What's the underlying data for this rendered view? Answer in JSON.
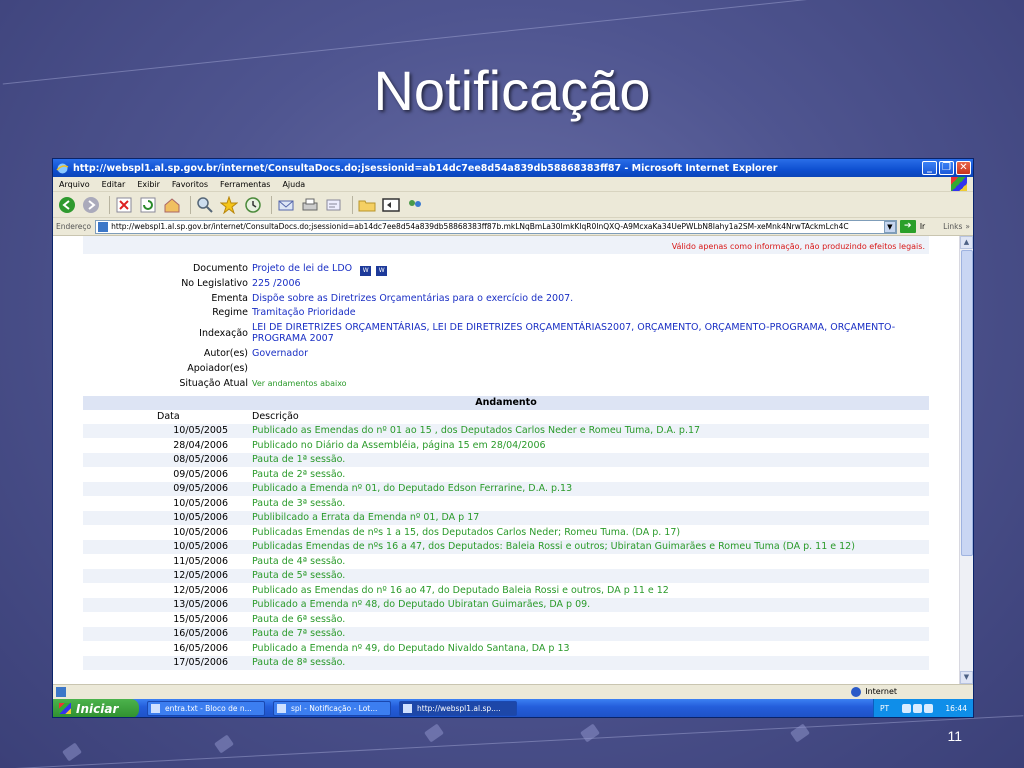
{
  "slide": {
    "title": "Notificação",
    "page_number": "11"
  },
  "browser": {
    "window_title": "http://webspl1.al.sp.gov.br/internet/ConsultaDocs.do;jsessionid=ab14dc7ee8d54a839db58868383ff87 - Microsoft Internet Explorer",
    "menu": [
      "Arquivo",
      "Editar",
      "Exibir",
      "Favoritos",
      "Ferramentas",
      "Ajuda"
    ],
    "address_label": "Endereço",
    "address_url": "http://webspl1.al.sp.gov.br/internet/ConsultaDocs.do;jsessionid=ab14dc7ee8d54a839db58868383ff87b.mkLNqBmLa30ImkKIqR0InQXQ-A9McxaKa34UePWLbN8Iahy1a2SM-xeMnk4NrwTAckmLch4C",
    "go_label": "Ir",
    "links_label": "Links",
    "status_zone": "Internet"
  },
  "page": {
    "notice": "Válido apenas como informação, não produzindo efeitos legais.",
    "fields": {
      "documento_label": "Documento",
      "documento_value": "Projeto de lei de LDO",
      "legislativo_label": "No Legislativo",
      "legislativo_value": "225 /2006",
      "ementa_label": "Ementa",
      "ementa_value": "Dispõe sobre as Diretrizes Orçamentárias para o exercício de 2007.",
      "regime_label": "Regime",
      "regime_value": "Tramitação Prioridade",
      "indexacao_label": "Indexação",
      "indexacao_value": "LEI DE DIRETRIZES ORÇAMENTÁRIAS, LEI DE DIRETRIZES ORÇAMENTÁRIAS2007, ORÇAMENTO, ORÇAMENTO-PROGRAMA, ORÇAMENTO-PROGRAMA 2007",
      "autor_label": "Autor(es)",
      "autor_value": "Governador",
      "apoiador_label": "Apoiador(es)",
      "apoiador_value": "",
      "situacao_label": "Situação Atual",
      "situacao_value": "Ver andamentos abaixo"
    },
    "andamento": {
      "title": "Andamento",
      "col_date": "Data",
      "col_desc": "Descrição",
      "rows": [
        {
          "date": "10/05/2005",
          "desc": "Publicado as Emendas do nº 01 ao 15 , dos Deputados Carlos Neder e Romeu Tuma, D.A. p.17"
        },
        {
          "date": "28/04/2006",
          "desc": "Publicado no Diário da Assembléia, página 15 em 28/04/2006"
        },
        {
          "date": "08/05/2006",
          "desc": "Pauta de 1ª sessão."
        },
        {
          "date": "09/05/2006",
          "desc": "Pauta de 2ª sessão."
        },
        {
          "date": "09/05/2006",
          "desc": "Publicado a Emenda nº 01, do Deputado Edson Ferrarine, D.A. p.13"
        },
        {
          "date": "10/05/2006",
          "desc": "Pauta de 3ª sessão."
        },
        {
          "date": "10/05/2006",
          "desc": "Publibilcado a Errata da Emenda nº 01, DA p 17"
        },
        {
          "date": "10/05/2006",
          "desc": "Publicadas Emendas de nºs 1 a 15, dos Deputados Carlos Neder; Romeu Tuma. (DA p. 17)"
        },
        {
          "date": "10/05/2006",
          "desc": "Publicadas Emendas de nºs 16 a 47, dos Deputados: Baleia Rossi e outros; Ubiratan Guimarães e Romeu Tuma (DA p. 11 e 12)"
        },
        {
          "date": "11/05/2006",
          "desc": "Pauta de 4ª sessão."
        },
        {
          "date": "12/05/2006",
          "desc": "Pauta de 5ª sessão."
        },
        {
          "date": "12/05/2006",
          "desc": "Publicado as Emendas do nº 16 ao 47, do Deputado Baleia Rossi e outros, DA p 11 e 12"
        },
        {
          "date": "13/05/2006",
          "desc": "Publicado a Emenda nº 48, do Deputado Ubiratan Guimarães, DA p 09."
        },
        {
          "date": "15/05/2006",
          "desc": "Pauta de 6ª sessão."
        },
        {
          "date": "16/05/2006",
          "desc": "Pauta de 7ª sessão."
        },
        {
          "date": "16/05/2006",
          "desc": "Publicado a Emenda nº 49, do Deputado Nivaldo Santana, DA p 13"
        },
        {
          "date": "17/05/2006",
          "desc": "Pauta de 8ª sessão."
        }
      ]
    }
  },
  "taskbar": {
    "start_label": "Iniciar",
    "tasks": [
      {
        "label": "entra.txt - Bloco de n...",
        "active": false
      },
      {
        "label": "spl - Notificação - Lot...",
        "active": false
      },
      {
        "label": "http://webspl1.al.sp....",
        "active": true
      }
    ],
    "language": "PT",
    "clock": "16:44"
  }
}
